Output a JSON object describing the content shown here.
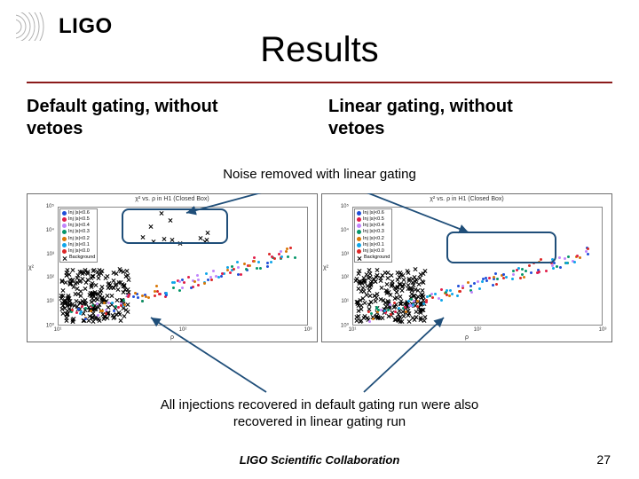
{
  "logo_text": "LIGO",
  "title": "Results",
  "left_heading_l1": "Default gating, without",
  "left_heading_l2": "vetoes",
  "right_heading_l1": "Linear gating, without",
  "right_heading_l2": "vetoes",
  "note1": "Noise removed with linear gating",
  "note2_l1": "All injections recovered in default gating run were also",
  "note2_l2": "recovered in linear gating run",
  "footer": "LIGO Scientific Collaboration",
  "page": "27",
  "legend": {
    "items": [
      {
        "label": "Inj |s|<0.6",
        "color": "#1f4ed8"
      },
      {
        "label": "Inj |s|<0.5",
        "color": "#e11d48"
      },
      {
        "label": "Inj |s|<0.4",
        "color": "#c084fc"
      },
      {
        "label": "Inj |s|<0.3",
        "color": "#059669"
      },
      {
        "label": "Inj |s|<0.2",
        "color": "#d97706"
      },
      {
        "label": "Inj |s|<0.1",
        "color": "#0ea5e9"
      },
      {
        "label": "Inj |s|<0.0",
        "color": "#dc2626"
      }
    ],
    "bg_label": "Background"
  },
  "chart_data": [
    {
      "type": "scatter",
      "title": "χ² vs. ρ in H1 (Closed Box)",
      "xlabel": "ρ",
      "ylabel": "χ²",
      "xlim": [
        10,
        1000
      ],
      "ylim": [
        1,
        100000
      ],
      "xticks": [
        "10¹",
        "10²",
        "10³"
      ],
      "yticks": [
        "10⁰",
        "10¹",
        "10²",
        "10³",
        "10⁴",
        "10⁵"
      ],
      "note": "Dense background X cluster lower-left; colored injection dots along rising diagonal; outlier X markers in upper-middle region (noise present)."
    },
    {
      "type": "scatter",
      "title": "χ² vs. ρ in H1 (Closed Box)",
      "xlabel": "ρ",
      "ylabel": "χ²",
      "xlim": [
        10,
        1000
      ],
      "ylim": [
        1,
        100000
      ],
      "xticks": [
        "10¹",
        "10²",
        "10³"
      ],
      "yticks": [
        "10⁰",
        "10¹",
        "10²",
        "10³",
        "10⁴",
        "10⁵"
      ],
      "note": "Dense background X cluster lower-left; colored injection dots along rising diagonal; upper-middle noise region is empty (noise removed)."
    }
  ],
  "colors": [
    "#1f4ed8",
    "#e11d48",
    "#c084fc",
    "#059669",
    "#d97706",
    "#0ea5e9",
    "#dc2626"
  ]
}
